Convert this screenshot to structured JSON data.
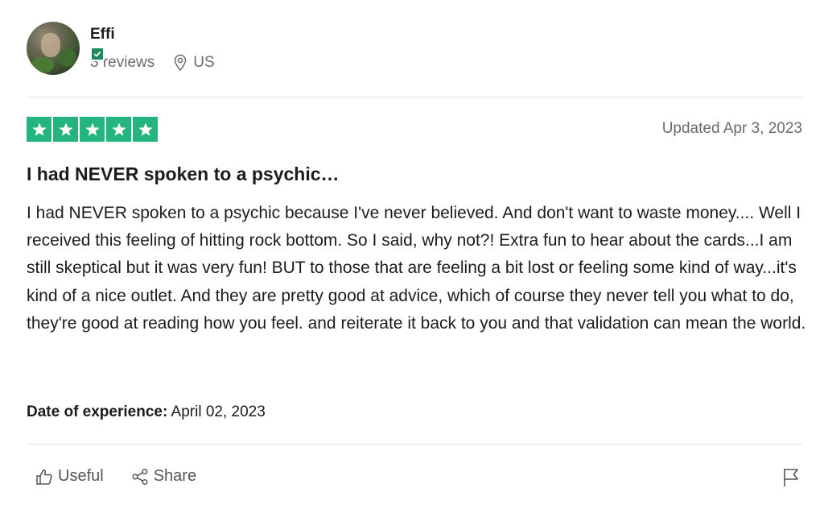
{
  "reviewer": {
    "name": "Effi",
    "reviews": "3 reviews",
    "location": "US"
  },
  "review": {
    "rating": 5,
    "rating_max": 5,
    "updated": "Updated Apr 3, 2023",
    "title": "I had NEVER spoken to a psychic…",
    "body": "I had NEVER spoken to a psychic because I've never believed. And don't want to waste money.... Well I received this feeling of hitting rock bottom. So I said, why not?! Extra fun to hear about the cards...I am still skeptical but it was very fun! BUT to those that are feeling a bit lost or feeling some kind of way...it's kind of a nice outlet. And they are pretty good at advice, which of course they never tell you what to do, they're good at reading how you feel. and reiterate it back to you and that validation can mean the world.",
    "experience_label": "Date of experience:",
    "experience_date": "April 02, 2023"
  },
  "actions": {
    "useful_label": "Useful",
    "share_label": "Share"
  },
  "colors": {
    "star_green": "#24b47e",
    "verified_green": "#1e8a5c",
    "text_dark": "#1c1c1c",
    "text_muted": "#6b6b6b"
  }
}
